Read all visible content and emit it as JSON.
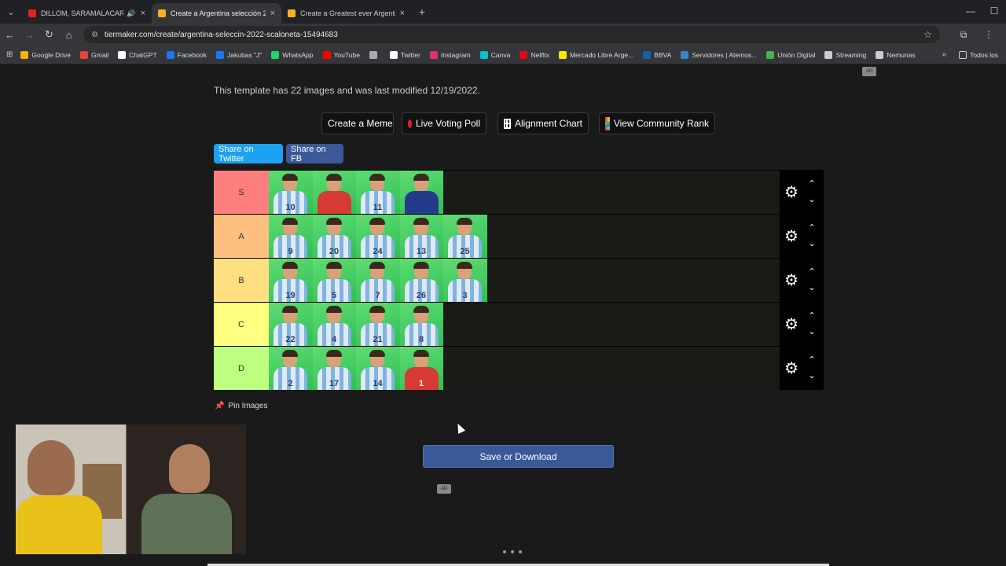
{
  "browser": {
    "tabs": [
      {
        "title": "DILLOM, SARAMALACARA",
        "favicon_color": "#e62117",
        "active": false,
        "audio": true
      },
      {
        "title": "Create a Argentina selección 20",
        "favicon_color": "#f3b11d",
        "active": true
      },
      {
        "title": "Create a Greatest ever Argentin",
        "favicon_color": "#f3b11d",
        "active": false
      }
    ],
    "url": "tiermaker.com/create/argentina-seleccin-2022-scaloneta-15494683",
    "bookmarks": [
      {
        "label": "Google Drive",
        "color": "#f4b400"
      },
      {
        "label": "Gmail",
        "color": "#ea4335"
      },
      {
        "label": "ChatGPT",
        "color": "#ffffff"
      },
      {
        "label": "Facebook",
        "color": "#1877f2"
      },
      {
        "label": "Jakubas \"J\"",
        "color": "#1877f2"
      },
      {
        "label": "WhatsApp",
        "color": "#25d366"
      },
      {
        "label": "YouTube",
        "color": "#ff0000"
      },
      {
        "label": "",
        "color": "#aaaaaa"
      },
      {
        "label": "Twitter",
        "color": "#ffffff"
      },
      {
        "label": "Instagram",
        "color": "#e1306c"
      },
      {
        "label": "Canva",
        "color": "#00c4cc"
      },
      {
        "label": "Netflix",
        "color": "#e50914"
      },
      {
        "label": "Mercado Libre Arge...",
        "color": "#ffe600"
      },
      {
        "label": "BBVA",
        "color": "#1464a5"
      },
      {
        "label": "Servidores | Atemos...",
        "color": "#3b82c4"
      },
      {
        "label": "Unión Digital",
        "color": "#4caf50"
      },
      {
        "label": "Streaming",
        "color": "#cccccc"
      },
      {
        "label": "Nemunas",
        "color": "#cccccc"
      }
    ],
    "bookmarks_all": "Todos los"
  },
  "page": {
    "ad_label": "AD",
    "template_info": "This template has 22 images and was last modified 12/19/2022.",
    "actions": {
      "meme": "Create a Meme",
      "live_poll": "Live Voting Poll",
      "alignment": "Alignment Chart",
      "community": "View Community Rank"
    },
    "share": {
      "twitter": "Share on Twitter",
      "facebook": "Share on FB"
    },
    "tiers": [
      {
        "label": "S",
        "color": "#ff7f7f",
        "players": [
          {
            "num": "10",
            "kit": "home"
          },
          {
            "num": "",
            "kit": "red"
          },
          {
            "num": "11",
            "kit": "home"
          },
          {
            "num": "",
            "kit": "navy"
          }
        ]
      },
      {
        "label": "A",
        "color": "#ffbf7f",
        "players": [
          {
            "num": "9",
            "kit": "home"
          },
          {
            "num": "20",
            "kit": "home"
          },
          {
            "num": "24",
            "kit": "home"
          },
          {
            "num": "13",
            "kit": "home"
          },
          {
            "num": "25",
            "kit": "home"
          }
        ]
      },
      {
        "label": "B",
        "color": "#ffdf7f",
        "players": [
          {
            "num": "19",
            "kit": "home"
          },
          {
            "num": "5",
            "kit": "home"
          },
          {
            "num": "7",
            "kit": "home"
          },
          {
            "num": "26",
            "kit": "home"
          },
          {
            "num": "3",
            "kit": "home"
          }
        ]
      },
      {
        "label": "C",
        "color": "#ffff7f",
        "players": [
          {
            "num": "22",
            "kit": "home"
          },
          {
            "num": "4",
            "kit": "home"
          },
          {
            "num": "21",
            "kit": "home"
          },
          {
            "num": "8",
            "kit": "home"
          }
        ]
      },
      {
        "label": "D",
        "color": "#bfff7f",
        "players": [
          {
            "num": "2",
            "kit": "home"
          },
          {
            "num": "17",
            "kit": "home"
          },
          {
            "num": "14",
            "kit": "home"
          },
          {
            "num": "1",
            "kit": "red"
          }
        ]
      }
    ],
    "pin_images": "Pin Images",
    "save_download": "Save or Download"
  }
}
